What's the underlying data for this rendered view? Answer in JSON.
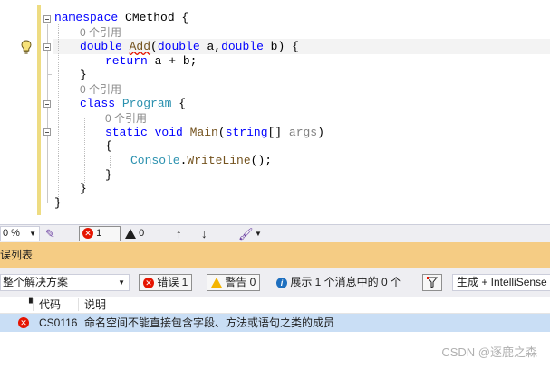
{
  "editor": {
    "lines": [
      {
        "parts": [
          [
            "kw",
            "namespace"
          ],
          [
            "tx",
            " CMethod {"
          ]
        ]
      },
      {
        "lens": "0 个引用"
      },
      {
        "parts": [
          [
            "kw",
            "double"
          ],
          [
            "tx",
            " "
          ],
          [
            "fnsq",
            "Add"
          ],
          [
            "tx",
            "("
          ],
          [
            "kw",
            "double"
          ],
          [
            "tx",
            " a,"
          ],
          [
            "kw",
            "double"
          ],
          [
            "tx",
            " b) {"
          ]
        ]
      },
      {
        "parts": [
          [
            "kw",
            "return"
          ],
          [
            "tx",
            " a + b;"
          ]
        ]
      },
      {
        "parts": [
          [
            "tx",
            "}"
          ]
        ]
      },
      {
        "lens": "0 个引用"
      },
      {
        "parts": [
          [
            "kw",
            "class"
          ],
          [
            "tx",
            " "
          ],
          [
            "tp",
            "Program"
          ],
          [
            "tx",
            " {"
          ]
        ]
      },
      {
        "lens": "0 个引用"
      },
      {
        "parts": [
          [
            "kw",
            "static"
          ],
          [
            "tx",
            " "
          ],
          [
            "kw",
            "void"
          ],
          [
            "tx",
            " "
          ],
          [
            "fn",
            "Main"
          ],
          [
            "tx",
            "("
          ],
          [
            "kw",
            "string"
          ],
          [
            "tx",
            "[] "
          ],
          [
            "pm",
            "args"
          ],
          [
            "tx",
            ")"
          ]
        ]
      },
      {
        "parts": [
          [
            "tx",
            "{"
          ]
        ]
      },
      {
        "parts": [
          [
            "tp",
            "Console"
          ],
          [
            "tx",
            "."
          ],
          [
            "fn",
            "WriteLine"
          ],
          [
            "tx",
            "();"
          ]
        ]
      },
      {
        "parts": [
          [
            "tx",
            "}"
          ]
        ]
      },
      {
        "parts": [
          [
            "tx",
            "}"
          ]
        ]
      },
      {
        "parts": [
          [
            "tx",
            "}"
          ]
        ]
      }
    ]
  },
  "status_bar": {
    "zoom": "0 %",
    "error_count": "1",
    "warning_count": "0",
    "up_arrow": "↑",
    "down_arrow": "↓"
  },
  "error_list": {
    "title": "误列表",
    "scope": "整个解决方案",
    "errors_filter": "错误 1",
    "warnings_filter": "警告 0",
    "messages_filter": "展示 1 个消息中的 0 个",
    "build_source": "生成 + IntelliSense",
    "columns": {
      "code": "代码",
      "description": "说明"
    },
    "rows": [
      {
        "code": "CS0116",
        "description": "命名空间不能直接包含字段、方法或语句之类的成员"
      }
    ]
  },
  "watermark": "CSDN @逐鹿之森",
  "colors": {
    "error": "#e51400",
    "warning": "#f4b400",
    "selected_row": "#c9def5",
    "panel_title": "#f5cc84"
  }
}
